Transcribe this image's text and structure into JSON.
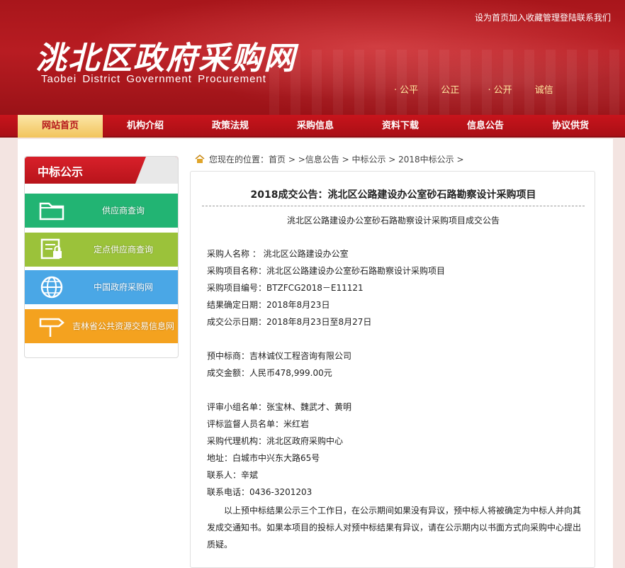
{
  "header": {
    "logo_cn": "洮北区政府采购网",
    "logo_en": "Taobei District Government Procurement",
    "links": [
      "设为首页",
      "加入收藏",
      "管理登陆",
      "联系我们"
    ],
    "slogan": [
      "公平",
      "公正",
      "公开",
      "诚信"
    ]
  },
  "nav": {
    "items": [
      "网站首页",
      "机构介绍",
      "政策法规",
      "采购信息",
      "资料下载",
      "信息公告",
      "协议供货"
    ],
    "active_index": 0
  },
  "sidebar": {
    "title": "中标公示",
    "buttons": [
      {
        "label": "供应商查询",
        "color": "#22b473",
        "icon": "folder-icon"
      },
      {
        "label": "定点供应商查询",
        "color": "#9bc23a",
        "icon": "document-lock-icon"
      },
      {
        "label": "中国政府采购网",
        "color": "#4aa7e6",
        "icon": "globe-icon"
      },
      {
        "label": "吉林省公共资源交易信息网",
        "color": "#f4a21f",
        "icon": "signpost-icon"
      }
    ]
  },
  "breadcrumb": {
    "prefix": "您现在的位置：",
    "path": "首页 > >信息公告 > 中标公示 > 2018中标公示 >"
  },
  "article": {
    "title": "2018成交公告：洮北区公路建设办公室砂石路勘察设计采购项目",
    "subtitle": "洮北区公路建设办公室砂石路勘察设计采购项目成交公告",
    "lines": [
      "采购人名称 ： 洮北区公路建设办公室",
      "采购项目名称：洮北区公路建设办公室砂石路勘察设计采购项目",
      "采购项目编号：BTZFCG2018－E11121",
      "结果确定日期：2018年8月23日",
      "成交公示日期：2018年8月23日至8月27日",
      "预中标商：吉林诚仪工程咨询有限公司",
      "成交金额：人民币478,999.00元",
      "评审小组名单：张宝林、魏武才、黄明",
      "评标监督人员名单：米红岩",
      "采购代理机构：洮北区政府采购中心",
      "地址：白城市中兴东大路65号",
      "联系人：辛斌",
      "联系电话：0436-3201203"
    ],
    "paragraph": "以上预中标结果公示三个工作日，在公示期间如果没有异议，预中标人将被确定为中标人并向其发成交通知书。如果本项目的投标人对预中标结果有异议，请在公示期内以书面方式向采购中心提出质疑。"
  }
}
